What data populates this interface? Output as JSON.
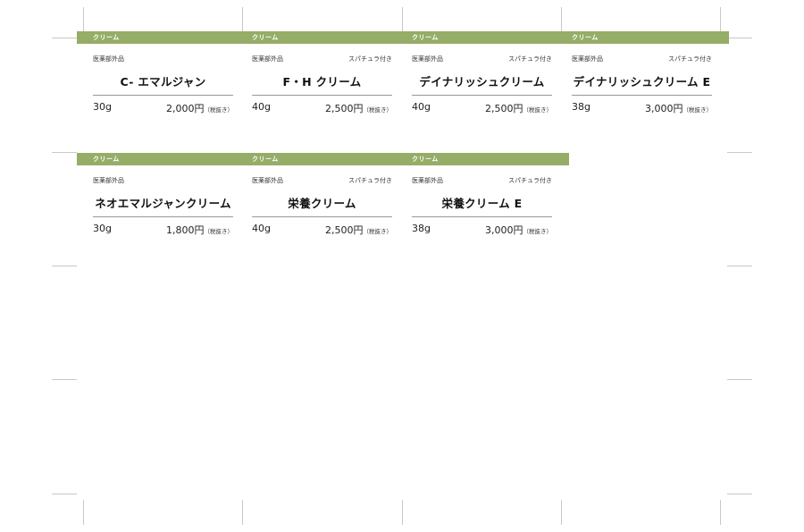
{
  "rows": [
    [
      {
        "category": "クリーム",
        "tag": "医薬部外品",
        "spatula": "",
        "name": "C- エマルジャン",
        "weight": "30g",
        "price": "2,000円",
        "tax": "（税抜き）"
      },
      {
        "category": "クリーム",
        "tag": "医薬部外品",
        "spatula": "スパチュラ付き",
        "name": "F・H クリーム",
        "weight": "40g",
        "price": "2,500円",
        "tax": "（税抜き）"
      },
      {
        "category": "クリーム",
        "tag": "医薬部外品",
        "spatula": "スパチュラ付き",
        "name": "デイナリッシュクリーム",
        "weight": "40g",
        "price": "2,500円",
        "tax": "（税抜き）"
      },
      {
        "category": "クリーム",
        "tag": "医薬部外品",
        "spatula": "スパチュラ付き",
        "name": "デイナリッシュクリーム E",
        "weight": "38g",
        "price": "3,000円",
        "tax": "（税抜き）"
      }
    ],
    [
      {
        "category": "クリーム",
        "tag": "医薬部外品",
        "spatula": "",
        "name": "ネオエマルジャンクリーム",
        "weight": "30g",
        "price": "1,800円",
        "tax": "（税抜き）"
      },
      {
        "category": "クリーム",
        "tag": "医薬部外品",
        "spatula": "スパチュラ付き",
        "name": "栄養クリーム",
        "weight": "40g",
        "price": "2,500円",
        "tax": "（税抜き）"
      },
      {
        "category": "クリーム",
        "tag": "医薬部外品",
        "spatula": "スパチュラ付き",
        "name": "栄養クリーム E",
        "weight": "38g",
        "price": "3,000円",
        "tax": "（税抜き）"
      }
    ]
  ],
  "colors": {
    "band": "#95ad66",
    "rule": "#999999",
    "crop_marks": "#c8c8c8"
  }
}
